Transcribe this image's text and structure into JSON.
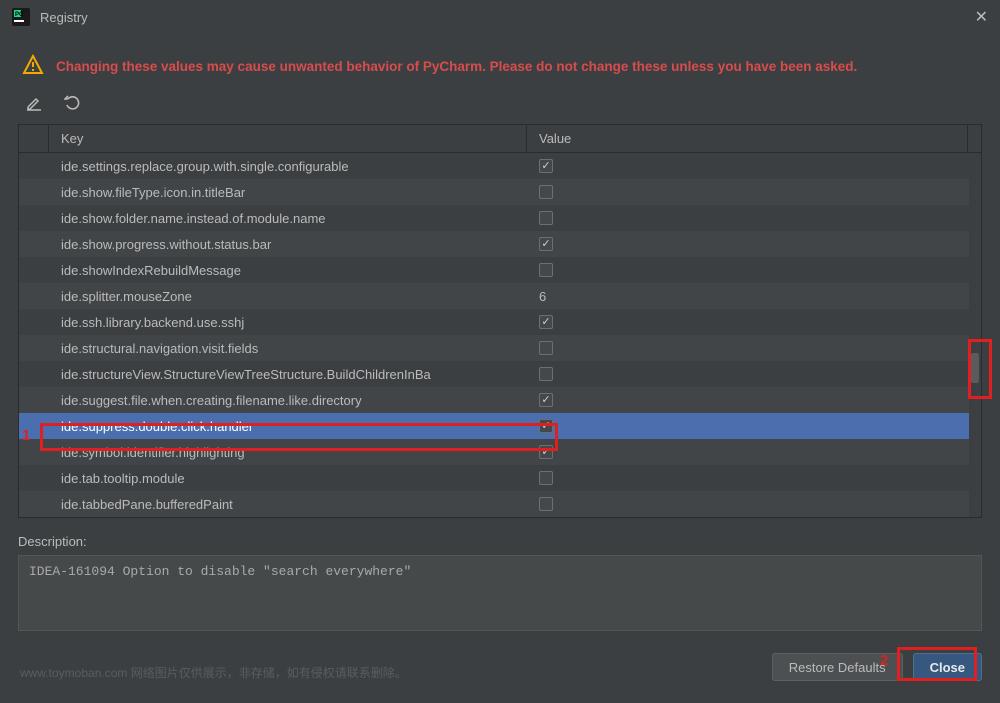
{
  "window": {
    "title": "Registry",
    "warning": "Changing these values may cause unwanted behavior of PyCharm. Please do not change these unless you have been asked.",
    "close_glyph": "✕"
  },
  "table": {
    "headers": {
      "key": "Key",
      "value": "Value"
    },
    "rows": [
      {
        "key": "ide.settings.replace.group.with.single.configurable",
        "checked": true,
        "selected": false
      },
      {
        "key": "ide.show.fileType.icon.in.titleBar",
        "checked": false,
        "selected": false
      },
      {
        "key": "ide.show.folder.name.instead.of.module.name",
        "checked": false,
        "selected": false
      },
      {
        "key": "ide.show.progress.without.status.bar",
        "checked": true,
        "selected": false
      },
      {
        "key": "ide.showIndexRebuildMessage",
        "checked": false,
        "selected": false
      },
      {
        "key": "ide.splitter.mouseZone",
        "text_value": "6",
        "selected": false
      },
      {
        "key": "ide.ssh.library.backend.use.sshj",
        "checked": true,
        "selected": false
      },
      {
        "key": "ide.structural.navigation.visit.fields",
        "checked": false,
        "selected": false
      },
      {
        "key": "ide.structureView.StructureViewTreeStructure.BuildChildrenInBa",
        "checked": false,
        "selected": false
      },
      {
        "key": "ide.suggest.file.when.creating.filename.like.directory",
        "checked": true,
        "selected": false
      },
      {
        "key": "ide.suppress.double.click.handler",
        "checked": true,
        "selected": true
      },
      {
        "key": "ide.symbol.identifier.highlighting",
        "checked": true,
        "selected": false
      },
      {
        "key": "ide.tab.tooltip.module",
        "checked": false,
        "selected": false
      },
      {
        "key": "ide.tabbedPane.bufferedPaint",
        "checked": false,
        "selected": false
      }
    ]
  },
  "description": {
    "label": "Description:",
    "text": "IDEA-161094 Option to disable \"search everywhere\""
  },
  "buttons": {
    "restore": "Restore Defaults",
    "close": "Close"
  },
  "annotations": {
    "one": "1",
    "two": "2"
  },
  "watermark": "www.toymoban.com 网络图片仅供展示，非存储，如有侵权请联系删除。"
}
